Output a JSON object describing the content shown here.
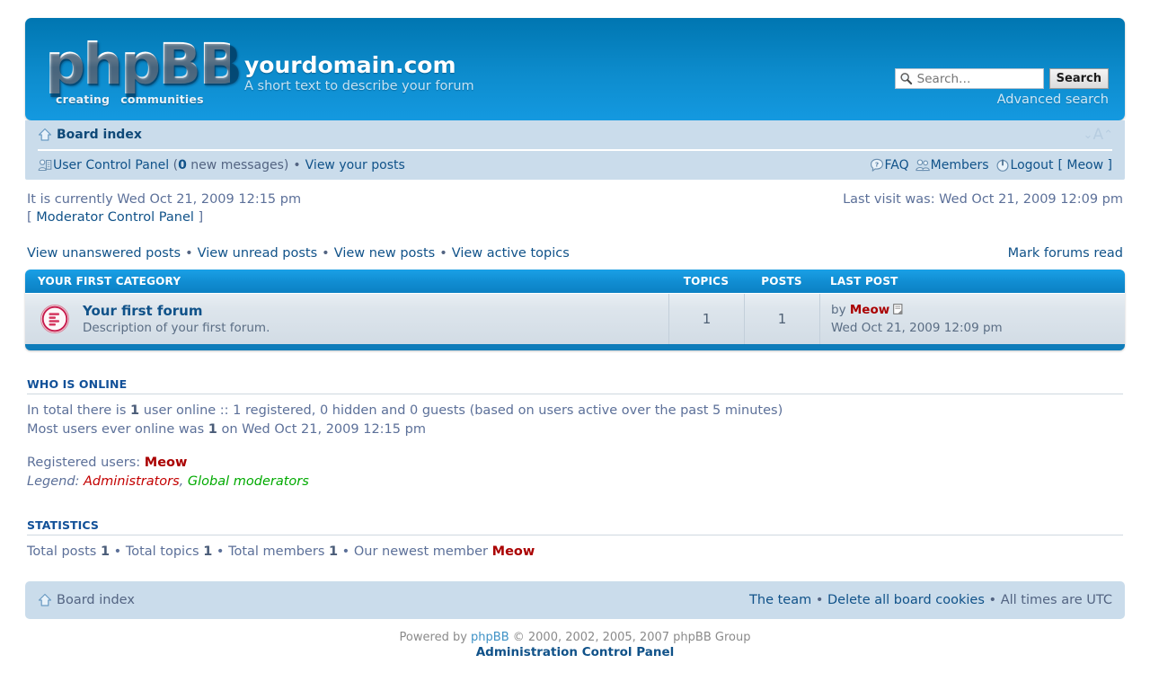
{
  "header": {
    "logo_text": "phpBB",
    "logo_sub_left": "creating",
    "logo_sub_right": "communities",
    "site_name": "yourdomain.com",
    "site_description": "A short text to describe your forum",
    "search": {
      "placeholder": "Search…",
      "value": "",
      "button_label": "Search",
      "advanced_label": "Advanced search",
      "icon": "search-icon"
    }
  },
  "navbar": {
    "breadcrumb_label": "Board index",
    "breadcrumb_icon": "home-icon",
    "fontsize": {
      "decrease": "⌄",
      "letter": "A",
      "increase": "⌃"
    },
    "left_links": {
      "ucp_icon": "user-control-panel-icon",
      "ucp_label": "User Control Panel",
      "new_messages_count": "0",
      "new_messages_suffix": " new messages",
      "separator": "•",
      "view_posts_label": "View your posts"
    },
    "right_links": {
      "faq_icon": "faq-icon",
      "faq_label": "FAQ",
      "members_icon": "members-icon",
      "members_label": "Members",
      "logout_icon": "power-icon",
      "logout_label": "Logout",
      "current_user": "[ Meow ]"
    }
  },
  "info": {
    "current_time": "It is currently Wed Oct 21, 2009 12:15 pm",
    "last_visit": "Last visit was: Wed Oct 21, 2009 12:09 pm",
    "mcp_label": "Moderator Control Panel",
    "mcp_open": "[ ",
    "mcp_close": " ]"
  },
  "quicklinks": {
    "items": [
      "View unanswered posts",
      "View unread posts",
      "View new posts",
      "View active topics"
    ],
    "separator": "•",
    "mark_read_label": "Mark forums read"
  },
  "forumlist": {
    "columns": {
      "category": "YOUR FIRST CATEGORY",
      "topics": "TOPICS",
      "posts": "POSTS",
      "lastpost": "LAST POST"
    },
    "rows": [
      {
        "icon": "forum-unread-icon",
        "name": "Your first forum",
        "description": "Description of your first forum.",
        "topics": "1",
        "posts": "1",
        "lastpost_by_prefix": "by",
        "lastpost_author": "Meow",
        "lastpost_goto_icon": "goto-last-post-icon",
        "lastpost_time": "Wed Oct 21, 2009 12:09 pm"
      }
    ]
  },
  "who_is_online": {
    "title": "WHO IS ONLINE",
    "total_prefix": "In total there is ",
    "total_count": "1",
    "total_suffix": " user online :: 1 registered, 0 hidden and 0 guests (based on users active over the past 5 minutes)",
    "record_prefix": "Most users ever online was ",
    "record_count": "1",
    "record_suffix": " on Wed Oct 21, 2009 12:15 pm",
    "registered_label": "Registered users: ",
    "registered_users": "Meow",
    "legend_label": "Legend: ",
    "legend_admins": "Administrators",
    "legend_comma": ", ",
    "legend_gmods": "Global moderators"
  },
  "statistics": {
    "title": "STATISTICS",
    "total_posts_label": "Total posts ",
    "total_posts": "1",
    "total_topics_label": " • Total topics ",
    "total_topics": "1",
    "total_members_label": " • Total members ",
    "total_members": "1",
    "newest_member_label": " • Our newest member ",
    "newest_member": "Meow"
  },
  "footer": {
    "board_index_label": "Board index",
    "board_index_icon": "home-icon",
    "the_team_label": "The team",
    "sep1": " • ",
    "delete_cookies_label": "Delete all board cookies",
    "sep2": " • ",
    "timezone_label": "All times are UTC",
    "powered_prefix": "Powered by ",
    "powered_brand": "phpBB",
    "powered_suffix": " © 2000, 2002, 2005, 2007 phpBB Group",
    "acp_label": "Administration Control Panel"
  },
  "colors": {
    "header_top": "#0076b1",
    "header_bottom": "#1499e0",
    "navbar_bg": "#cadceb",
    "link": "#105289",
    "admin_red": "#aa0000",
    "gmod_green": "#00aa00",
    "row_bg": "#d4dde5"
  }
}
